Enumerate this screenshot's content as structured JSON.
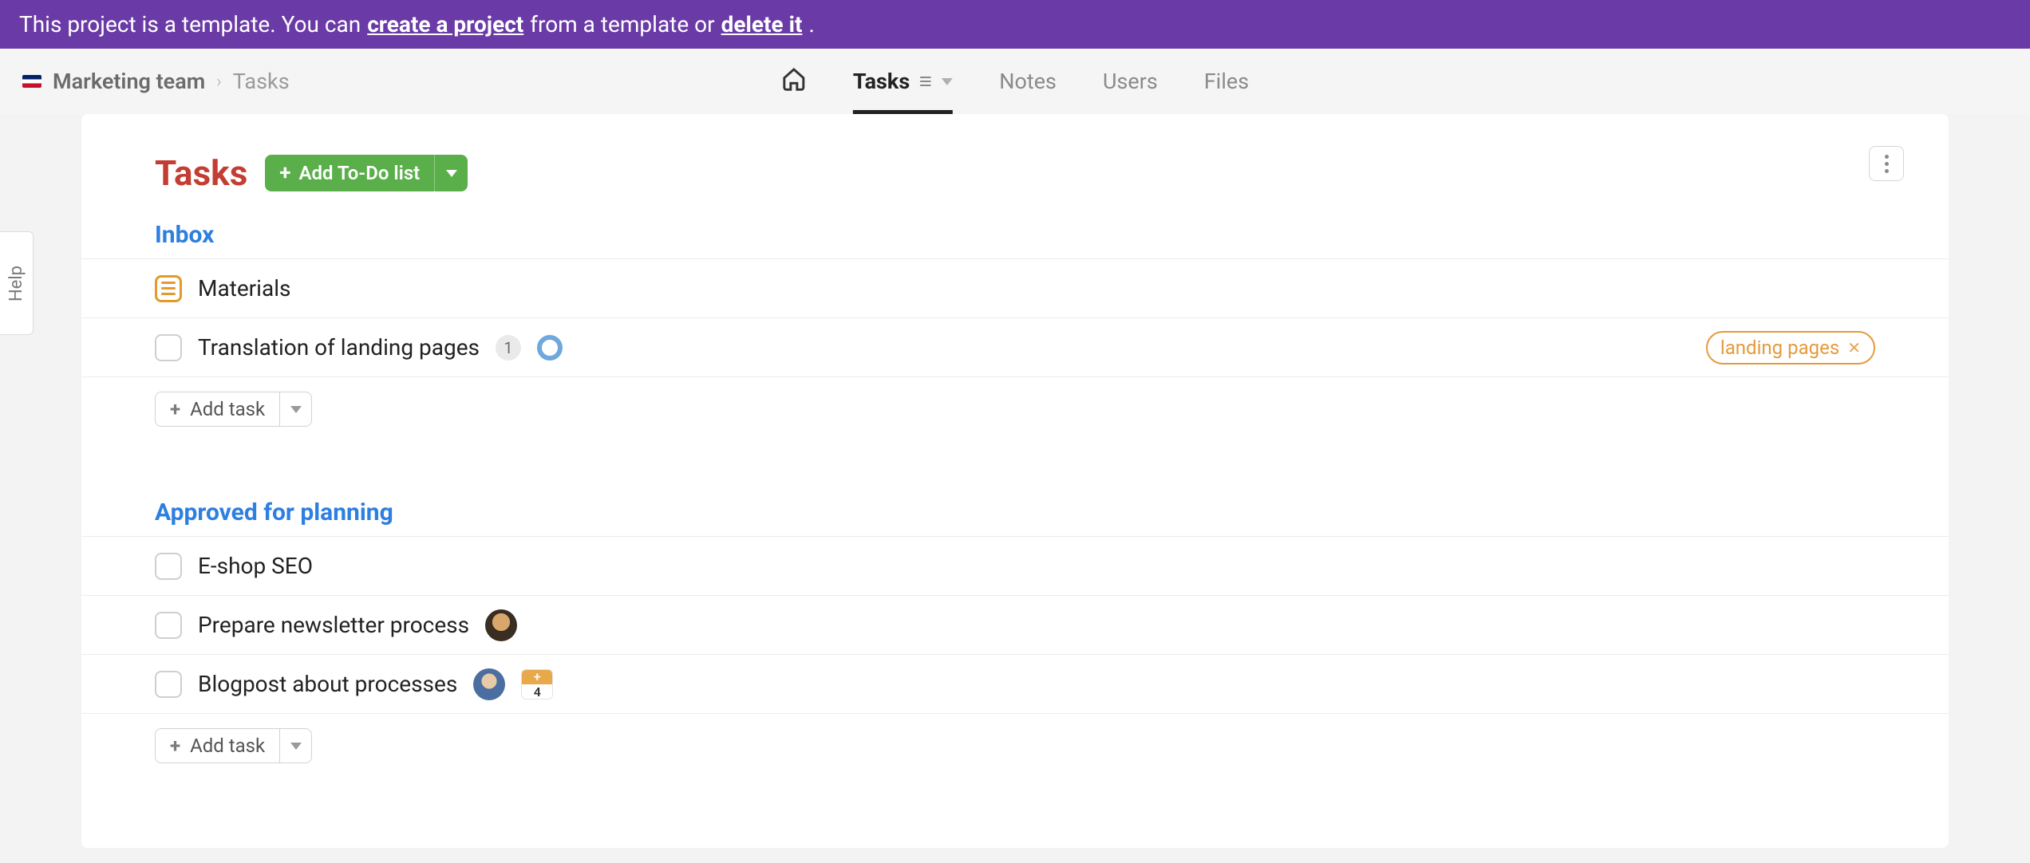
{
  "banner": {
    "prefix": "This project is a template. You can ",
    "create_link": "create a project",
    "middle": " from a template or ",
    "delete_link": "delete it",
    "suffix": "."
  },
  "breadcrumb": {
    "project": "Marketing team",
    "current": "Tasks"
  },
  "nav": {
    "tasks": "Tasks",
    "notes": "Notes",
    "users": "Users",
    "files": "Files"
  },
  "page": {
    "title": "Tasks",
    "add_list_label": "Add To-Do list",
    "add_task_label": "Add task"
  },
  "sections": [
    {
      "title": "Inbox",
      "tasks": [
        {
          "type": "list-task",
          "title": "Materials"
        },
        {
          "type": "task",
          "title": "Translation of landing pages",
          "count": "1",
          "status_ring": true,
          "tag": "landing pages"
        }
      ]
    },
    {
      "title": "Approved for planning",
      "tasks": [
        {
          "type": "task",
          "title": "E-shop SEO"
        },
        {
          "type": "task",
          "title": "Prepare newsletter process",
          "avatar": "a"
        },
        {
          "type": "task",
          "title": "Blogpost about processes",
          "avatar": "b",
          "extra_plus": "+",
          "extra_count": "4"
        }
      ]
    }
  ],
  "help": {
    "label": "Help"
  }
}
